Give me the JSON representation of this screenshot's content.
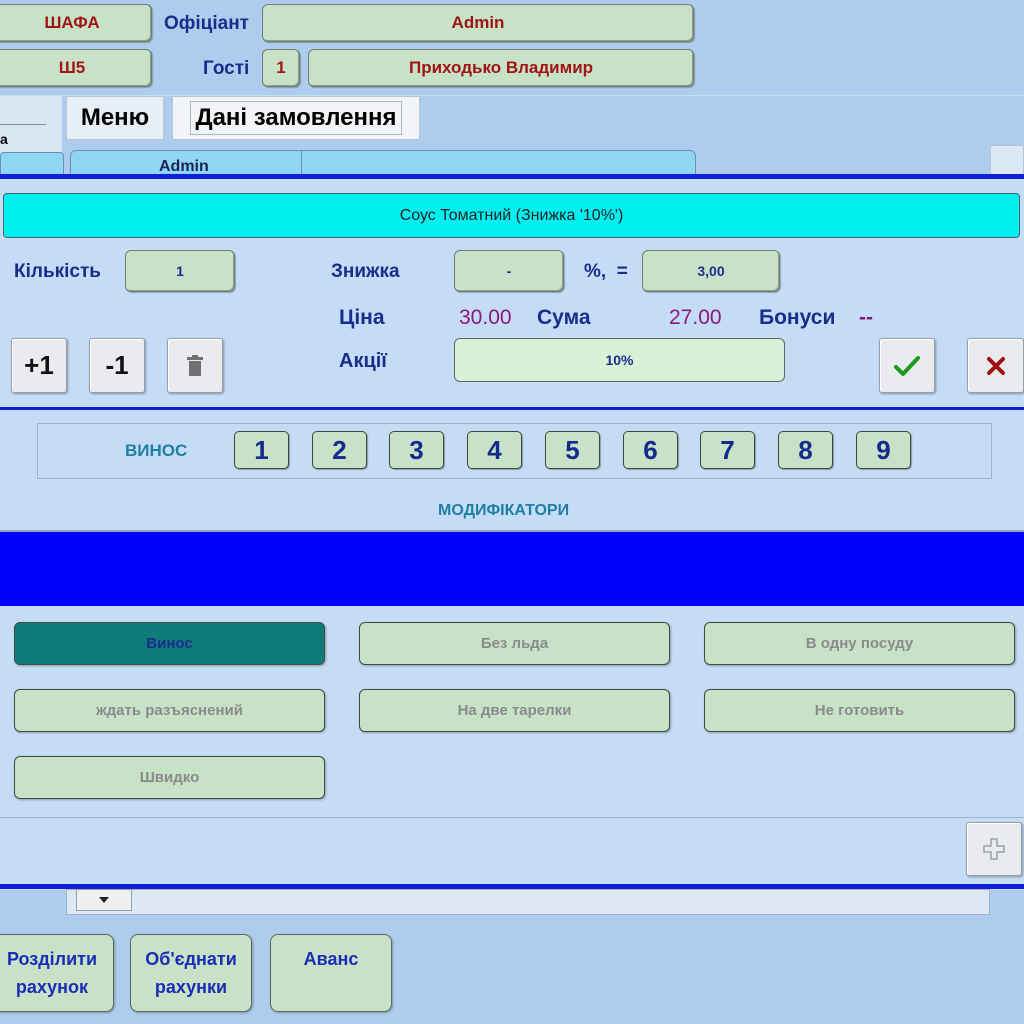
{
  "header": {
    "table_btn": "ШАФА",
    "waiter_label": "Офіціант",
    "waiter_value": "Admin",
    "sub_table_btn": "Ш5",
    "guests_label": "Гості",
    "guests_value": "1",
    "customer_value": "Приходько Владимир"
  },
  "tabs": {
    "menu": "Меню",
    "order_data": "Дані замовлення",
    "left_fragment": "а",
    "row_admin": "Admin"
  },
  "dialog": {
    "item_title": "Соус Томатний (Знижка '10%')",
    "quantity_label": "Кількість",
    "quantity_value": "1",
    "discount_label": "Знижка",
    "discount_value": "-",
    "percent_eq": "%,  =",
    "discount_amount": "3,00",
    "price_label": "Ціна",
    "price_value": "30.00",
    "sum_label": "Сума",
    "sum_value": "27.00",
    "bonus_label": "Бонуси",
    "bonus_value": "--",
    "plus_one": "+1",
    "minus_one": "-1",
    "promo_label": "Акції",
    "promo_value": "10%",
    "takeaway_label": "ВИНОС",
    "course_numbers": [
      "1",
      "2",
      "3",
      "4",
      "5",
      "6",
      "7",
      "8",
      "9"
    ],
    "modifiers_title": "МОДИФІКАТОРИ",
    "modifiers": [
      "Винос",
      "Без льда",
      "В одну посуду",
      "ждать разъяснений",
      "На две тарелки",
      "Не готовить",
      "Швидко"
    ]
  },
  "footer": {
    "split_line1": "Розділити",
    "split_line2": "рахунок",
    "merge_line1": "Об'єднати",
    "merge_line2": "рахунки",
    "advance": "Аванс"
  },
  "colors": {
    "background": "#aecdee",
    "dialog_bg": "#c5dcf6",
    "title_cyan": "#00f0f0",
    "blue_band": "#0000ff",
    "accent_line": "#1020d8",
    "price_purple": "#8a1a7a",
    "active_modifier": "#0f7b7b"
  },
  "icons": {
    "delete": "trash-icon",
    "confirm": "check-icon",
    "cancel": "close-icon",
    "add": "plus-icon",
    "dropdown": "chevron-down-icon"
  }
}
